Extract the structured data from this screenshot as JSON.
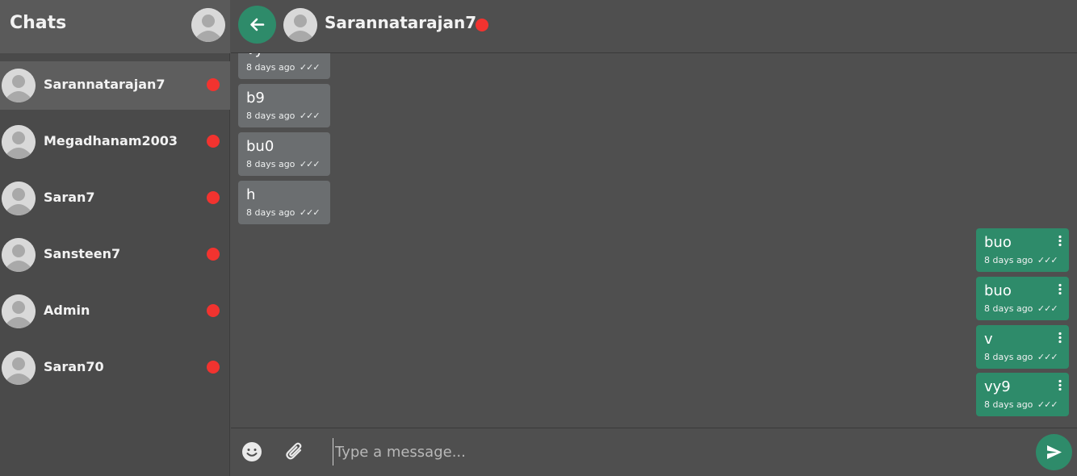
{
  "sidebar": {
    "title": "Chats",
    "chats": [
      {
        "name": "Sarannatarajan7",
        "active": true
      },
      {
        "name": "Megadhanam2003",
        "active": false
      },
      {
        "name": "Saran7",
        "active": false
      },
      {
        "name": "Sansteen7",
        "active": false
      },
      {
        "name": "Admin",
        "active": false
      },
      {
        "name": "Saran70",
        "active": false
      }
    ]
  },
  "header": {
    "contact_name": "Sarannatarajan7",
    "status_color": "#f2332f",
    "accent_color": "#2e8b6a"
  },
  "messages": {
    "incoming": [
      {
        "text": "vy",
        "time": "8 days ago",
        "ticks": "✓✓✓"
      },
      {
        "text": "b9",
        "time": "8 days ago",
        "ticks": "✓✓✓"
      },
      {
        "text": "bu0",
        "time": "8 days ago",
        "ticks": "✓✓✓"
      },
      {
        "text": "h",
        "time": "8 days ago",
        "ticks": "✓✓✓"
      }
    ],
    "outgoing": [
      {
        "text": "buo",
        "time": "8 days ago",
        "ticks": "✓✓✓"
      },
      {
        "text": "buo",
        "time": "8 days ago",
        "ticks": "✓✓✓"
      },
      {
        "text": "v",
        "time": "8 days ago",
        "ticks": "✓✓✓"
      },
      {
        "text": "vy9",
        "time": "8 days ago",
        "ticks": "✓✓✓"
      }
    ]
  },
  "composer": {
    "placeholder": "Type a message..."
  }
}
